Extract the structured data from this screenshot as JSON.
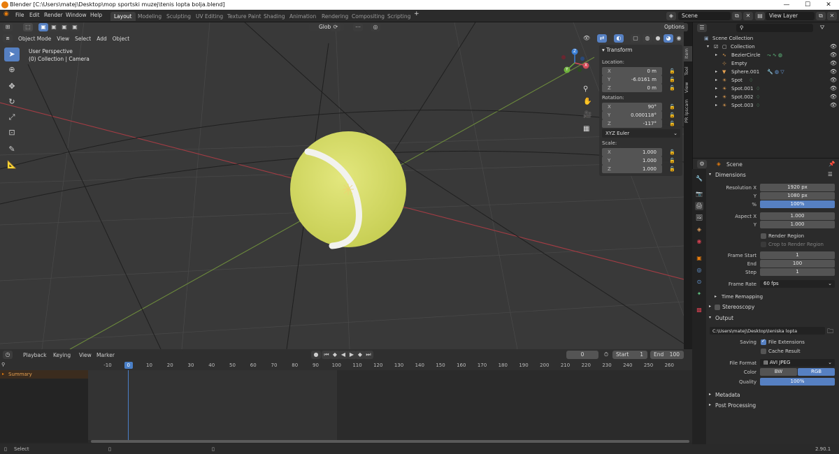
{
  "window": {
    "title": "Blender [C:\\Users\\matej\\Desktop\\mop sportski muzej\\tenis lopta bolja.blend]",
    "minimize": "—",
    "maximize": "☐",
    "close": "✕"
  },
  "menu": [
    "File",
    "Edit",
    "Render",
    "Window",
    "Help"
  ],
  "workspaces": [
    "Layout",
    "Modeling",
    "Sculpting",
    "UV Editing",
    "Texture Paint",
    "Shading",
    "Animation",
    "Rendering",
    "Compositing",
    "Scripting"
  ],
  "workspace_add": "+",
  "scene_name": "Scene",
  "view_layer": "View Layer",
  "viewport": {
    "mode": "Object Mode",
    "menus": [
      "View",
      "Select",
      "Add",
      "Object"
    ],
    "orientation": "Global",
    "options": "Options",
    "info_line1": "User Perspective",
    "info_line2": "(0) Collection | Camera",
    "gizmo": {
      "x": "X",
      "y": "Y",
      "z": "Z"
    }
  },
  "transform": {
    "header": "Transform",
    "location_label": "Location:",
    "location": [
      {
        "axis": "X",
        "value": "0 m"
      },
      {
        "axis": "Y",
        "value": "-6.0161 m"
      },
      {
        "axis": "Z",
        "value": "0 m"
      }
    ],
    "rotation_label": "Rotation:",
    "rotation": [
      {
        "axis": "X",
        "value": "90°"
      },
      {
        "axis": "Y",
        "value": "0.000118°"
      },
      {
        "axis": "Z",
        "value": "-117°"
      }
    ],
    "rotation_mode": "XYZ Euler",
    "scale_label": "Scale:",
    "scale": [
      {
        "axis": "X",
        "value": "1.000"
      },
      {
        "axis": "Y",
        "value": "1.000"
      },
      {
        "axis": "Z",
        "value": "1.000"
      }
    ]
  },
  "sidetabs": [
    "Item",
    "Tool",
    "View",
    "PR Ipscam"
  ],
  "timeline": {
    "menus": [
      "Playback",
      "Keying",
      "View",
      "Marker"
    ],
    "current_frame": "0",
    "start_label": "Start",
    "start": "1",
    "end_label": "End",
    "end": "100",
    "ticks": [
      "-10",
      "0",
      "10",
      "20",
      "30",
      "40",
      "50",
      "60",
      "70",
      "80",
      "90",
      "100",
      "110",
      "120",
      "130",
      "140",
      "150",
      "160",
      "170",
      "180",
      "190",
      "200",
      "210",
      "220",
      "230",
      "240",
      "250",
      "260"
    ],
    "summary": "Summary"
  },
  "status": {
    "select": "Select",
    "version": "2.90.1"
  },
  "outliner": {
    "scene_collection": "Scene Collection",
    "collection": "Collection",
    "items": [
      "BezierCircle",
      "Empty",
      "Sphere.001",
      "Spot",
      "Spot.001",
      "Spot.002",
      "Spot.003"
    ]
  },
  "properties": {
    "context": "Scene",
    "dimensions": "Dimensions",
    "res_x_label": "Resolution X",
    "res_x": "1920 px",
    "res_y_label": "Y",
    "res_y": "1080 px",
    "res_pct_label": "%",
    "res_pct": "100%",
    "aspect_x_label": "Aspect X",
    "aspect_x": "1.000",
    "aspect_y_label": "Y",
    "aspect_y": "1.000",
    "render_region": "Render Region",
    "crop_region": "Crop to Render Region",
    "frame_start_label": "Frame Start",
    "frame_start": "1",
    "end_label": "End",
    "end": "100",
    "step_label": "Step",
    "step": "1",
    "frame_rate_label": "Frame Rate",
    "frame_rate": "60 fps",
    "time_remapping": "Time Remapping",
    "stereoscopy": "Stereoscopy",
    "output": "Output",
    "output_path": "C:\\Users\\matej\\Desktop\\teniska lopta",
    "saving_label": "Saving",
    "file_extensions": "File Extensions",
    "cache_result": "Cache Result",
    "file_format_label": "File Format",
    "file_format": "AVI JPEG",
    "color_label": "Color",
    "color_bw": "BW",
    "color_rgb": "RGB",
    "quality_label": "Quality",
    "quality": "100%",
    "metadata": "Metadata",
    "post_processing": "Post Processing"
  },
  "colors": {
    "accent": "#5680c2",
    "ball": "#d6dc6a",
    "active_frame": "#4a7fc6"
  }
}
